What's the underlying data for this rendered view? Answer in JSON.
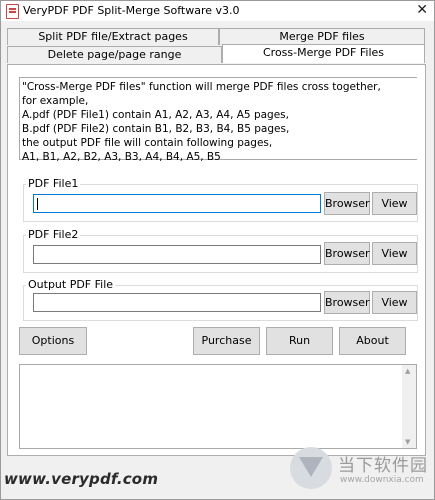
{
  "window": {
    "title": "VeryPDF PDF Split-Merge Software v3.0",
    "close_glyph": "✕"
  },
  "tabs": [
    {
      "label": "Split PDF file/Extract pages"
    },
    {
      "label": "Merge PDF files"
    },
    {
      "label": "Delete page/page range"
    },
    {
      "label": "Cross-Merge PDF Files",
      "active": true
    }
  ],
  "description": [
    "\"Cross-Merge PDF files\" function will merge PDF files cross together,",
    "for example,",
    "A.pdf (PDF File1) contain A1, A2, A3, A4, A5 pages,",
    "B.pdf (PDF File2) contain B1, B2, B3, B4, B5 pages,",
    "the output PDF file will contain following pages,",
    "A1, B1, A2, B2, A3, B3, A4, B4, A5, B5"
  ],
  "groups": {
    "file1": {
      "label": "PDF File1",
      "value": "",
      "browse": "Browser",
      "view": "View"
    },
    "file2": {
      "label": "PDF File2",
      "value": "",
      "browse": "Browser",
      "view": "View"
    },
    "output": {
      "label": "Output PDF File",
      "value": "",
      "browse": "Browser",
      "view": "View"
    }
  },
  "actions": {
    "options": "Options",
    "purchase": "Purchase",
    "run": "Run",
    "about": "About"
  },
  "log": {
    "value": ""
  },
  "footer": {
    "url": "www.verypdf.com"
  },
  "watermark": {
    "cn": "当下软件园",
    "en": "www.downxia.com"
  }
}
